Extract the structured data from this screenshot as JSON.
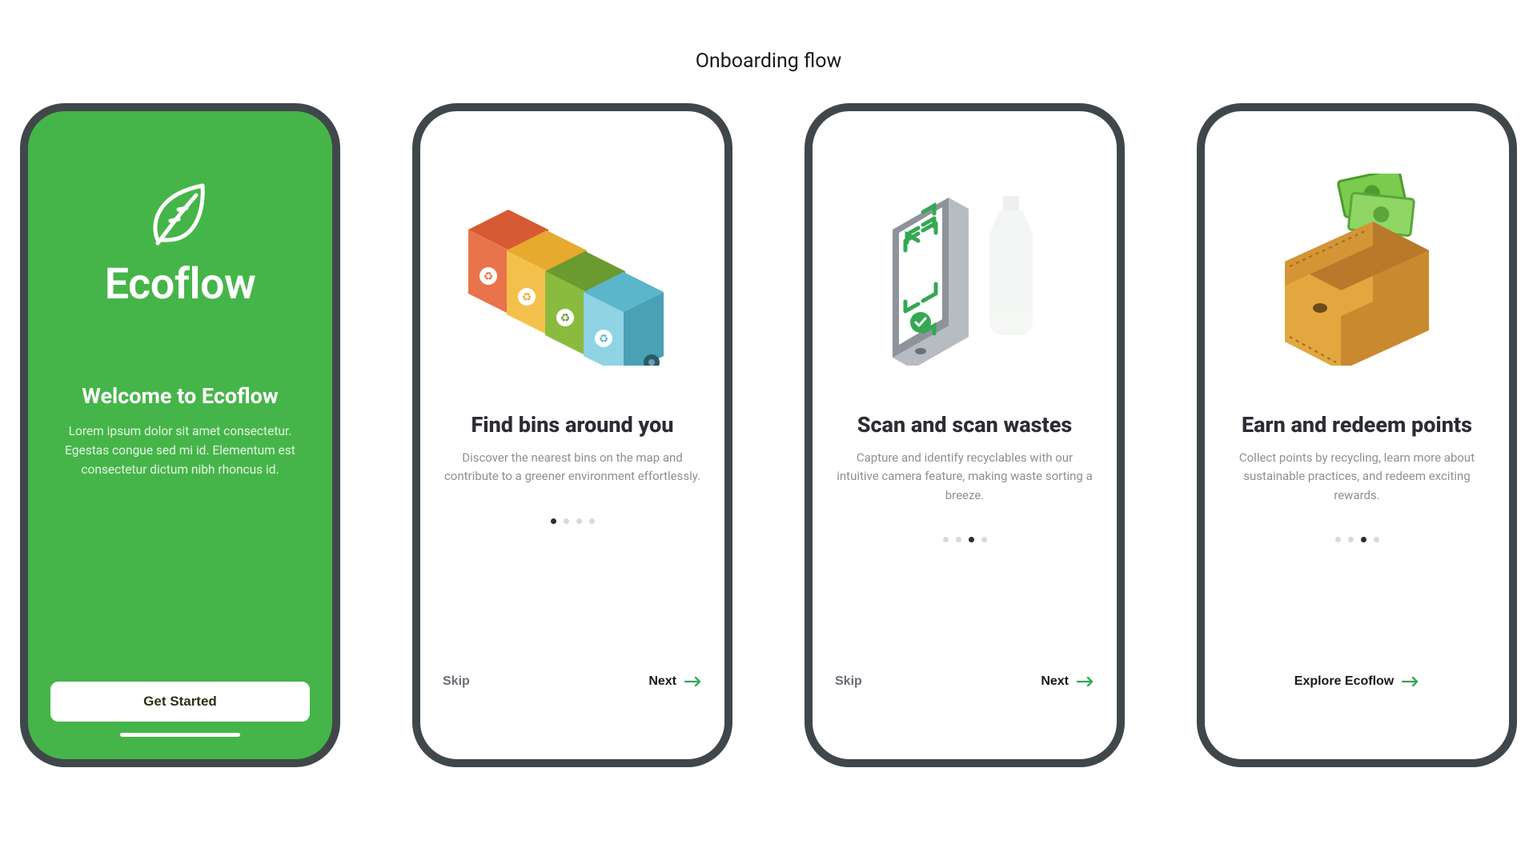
{
  "page_title": "Onboarding flow",
  "colors": {
    "brand_green": "#45b549",
    "accent_arrow": "#34a853"
  },
  "screen1": {
    "brand": "Ecoflow",
    "title": "Welcome to Ecoflow",
    "body": "Lorem ipsum dolor sit amet consectetur. Egestas congue sed mi id. Elementum est consectetur dictum nibh rhoncus id.",
    "cta": "Get Started"
  },
  "screen2": {
    "title": "Find bins around you",
    "body": "Discover the nearest bins on the map and contribute to a greener environment effortlessly.",
    "skip": "Skip",
    "next": "Next",
    "active_dot": 0
  },
  "screen3": {
    "title": "Scan and scan wastes",
    "body": "Capture and identify recyclables with our intuitive camera feature, making waste sorting a breeze.",
    "skip": "Skip",
    "next": "Next",
    "active_dot": 2
  },
  "screen4": {
    "title": "Earn and redeem points",
    "body": "Collect points by recycling, learn more about sustainable practices, and redeem exciting rewards.",
    "cta": "Explore Ecoflow",
    "active_dot": 2
  }
}
